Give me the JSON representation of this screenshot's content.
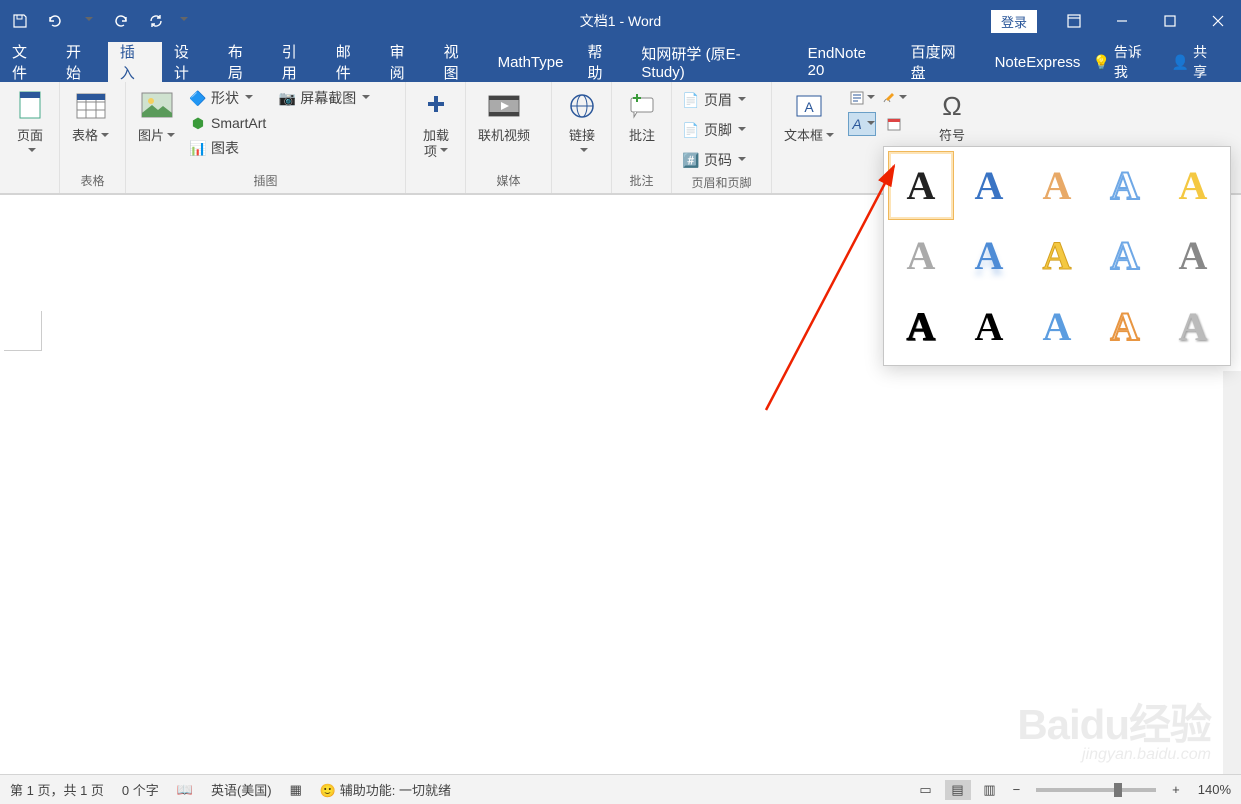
{
  "title": "文档1  -  Word",
  "login": "登录",
  "menu": {
    "file": "文件",
    "home": "开始",
    "insert": "插入",
    "design": "设计",
    "layout": "布局",
    "references": "引用",
    "mail": "邮件",
    "review": "审阅",
    "view": "视图",
    "mathtype": "MathType",
    "help": "帮助",
    "cnki": "知网研学 (原E-Study)",
    "endnote": "EndNote 20",
    "baidudisk": "百度网盘",
    "noteexpress": "NoteExpress",
    "tellme": "告诉我",
    "share": "共享"
  },
  "ribbon": {
    "pages": {
      "btn": "页面",
      "group": ""
    },
    "tables": {
      "btn": "表格",
      "group": "表格"
    },
    "pictures": {
      "btn": "图片"
    },
    "shapes": "形状",
    "smartart": "SmartArt",
    "chart": "图表",
    "screenshot": "屏幕截图",
    "illust_group": "插图",
    "addins": {
      "btn": "加载\n项",
      "group": ""
    },
    "video": "联机视频",
    "media_group": "媒体",
    "links": {
      "btn": "链接",
      "group": ""
    },
    "comment": "批注",
    "comment_group": "批注",
    "header": "页眉",
    "footer": "页脚",
    "pagenum": "页码",
    "hf_group": "页眉和页脚",
    "textbox": "文本框",
    "symbol": "符号"
  },
  "status": {
    "page": "第 1 页，共 1 页",
    "words": "0 个字",
    "lang": "英语(美国)",
    "access": "辅助功能: 一切就绪",
    "zoom": "140%"
  },
  "watermark": {
    "l1": "Baidu经验",
    "l2": "jingyan.baidu.com"
  }
}
